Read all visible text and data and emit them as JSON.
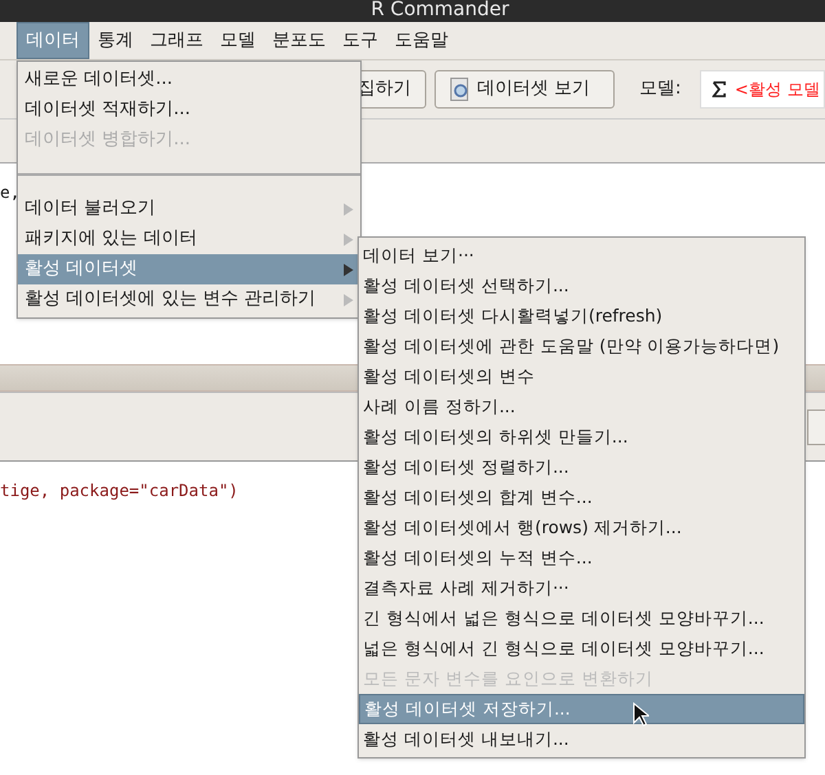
{
  "window": {
    "title": "R Commander"
  },
  "menubar": [
    {
      "label": "데이터",
      "selected": true
    },
    {
      "label": "통계",
      "selected": false
    },
    {
      "label": "그래프",
      "selected": false
    },
    {
      "label": "모델",
      "selected": false
    },
    {
      "label": "분포도",
      "selected": false
    },
    {
      "label": "도구",
      "selected": false
    },
    {
      "label": "도움말",
      "selected": false
    }
  ],
  "toolbar": {
    "edit_button": "집하기",
    "view_button": "데이터셋 보기",
    "model_label": "모델:",
    "model_value": "<활성 모델"
  },
  "script": {
    "line": "e,"
  },
  "output": {
    "line": "tige, package=\"carData\")"
  },
  "data_menu": [
    {
      "kind": "item",
      "label": "새로운 데이터셋...",
      "disabled": false,
      "selected": false,
      "submenu": false
    },
    {
      "kind": "item",
      "label": "데이터셋 적재하기...",
      "disabled": false,
      "selected": false,
      "submenu": false
    },
    {
      "kind": "item",
      "label": "데이터셋 병합하기...",
      "disabled": true,
      "selected": false,
      "submenu": false
    },
    {
      "kind": "separator"
    },
    {
      "kind": "item",
      "label": "데이터 불러오기",
      "disabled": false,
      "selected": false,
      "submenu": true
    },
    {
      "kind": "item",
      "label": "패키지에 있는 데이터",
      "disabled": false,
      "selected": false,
      "submenu": true
    },
    {
      "kind": "item",
      "label": "활성 데이터셋",
      "disabled": false,
      "selected": true,
      "submenu": true
    },
    {
      "kind": "item",
      "label": "활성 데이터셋에 있는 변수 관리하기",
      "disabled": false,
      "selected": false,
      "submenu": true
    }
  ],
  "submenu": [
    {
      "label": "데이터 보기···",
      "disabled": false,
      "selected": false
    },
    {
      "label": "활성 데이터셋 선택하기...",
      "disabled": false,
      "selected": false
    },
    {
      "label": "활성 데이터셋 다시활력넣기(refresh)",
      "disabled": false,
      "selected": false
    },
    {
      "label": "활성 데이터셋에 관한 도움말 (만약 이용가능하다면)",
      "disabled": false,
      "selected": false
    },
    {
      "label": "활성 데이터셋의 변수",
      "disabled": false,
      "selected": false
    },
    {
      "label": "사례 이름 정하기...",
      "disabled": false,
      "selected": false
    },
    {
      "label": "활성 데이터셋의 하위셋 만들기...",
      "disabled": false,
      "selected": false
    },
    {
      "label": "활성 데이터셋 정렬하기...",
      "disabled": false,
      "selected": false
    },
    {
      "label": "활성 데이터셋의 합계 변수...",
      "disabled": false,
      "selected": false
    },
    {
      "label": "활성 데이터셋에서 행(rows) 제거하기...",
      "disabled": false,
      "selected": false
    },
    {
      "label": "활성 데이터셋의 누적 변수...",
      "disabled": false,
      "selected": false
    },
    {
      "label": "결측자료 사례 제거하기···",
      "disabled": false,
      "selected": false
    },
    {
      "label": "긴 형식에서 넓은 형식으로 데이터셋 모양바꾸기...",
      "disabled": false,
      "selected": false
    },
    {
      "label": "넓은 형식에서 긴 형식으로 데이터셋 모양바꾸기...",
      "disabled": false,
      "selected": false
    },
    {
      "label": "모든 문자 변수를 요인으로 변환하기",
      "disabled": true,
      "selected": false
    },
    {
      "label": "활성 데이터셋 저장하기...",
      "disabled": false,
      "selected": true
    },
    {
      "label": "활성 데이터셋 내보내기...",
      "disabled": false,
      "selected": false
    }
  ]
}
